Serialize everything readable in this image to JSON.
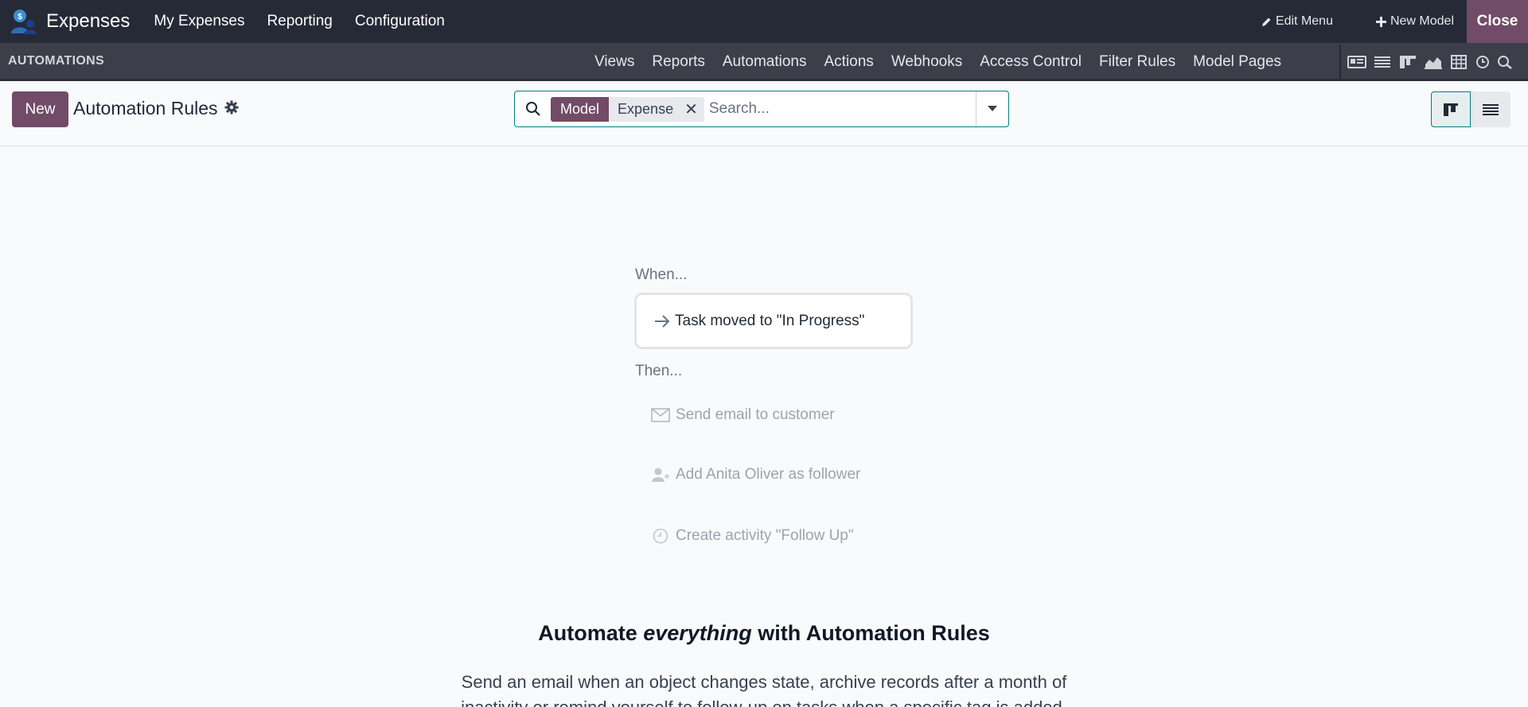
{
  "topbar": {
    "app_name": "Expenses",
    "menu": [
      "My Expenses",
      "Reporting",
      "Configuration"
    ],
    "edit_menu": "Edit Menu",
    "new_model": "New Model",
    "close": "Close"
  },
  "subbar": {
    "title": "AUTOMATIONS",
    "tabs": [
      "Views",
      "Reports",
      "Automations",
      "Actions",
      "Webhooks",
      "Access Control",
      "Filter Rules",
      "Model Pages"
    ],
    "view_icons": [
      "form-view-icon",
      "list-view-icon",
      "kanban-view-icon",
      "graph-view-icon",
      "pivot-view-icon",
      "activity-view-icon",
      "search-view-icon"
    ]
  },
  "control": {
    "new_button": "New",
    "page_title": "Automation Rules",
    "facet_key": "Model",
    "facet_value": "Expense",
    "search_placeholder": "Search..."
  },
  "helper": {
    "when": "When...",
    "trigger": "Task moved to \"In Progress\"",
    "then": "Then...",
    "actions": [
      "Send email to customer",
      "Add Anita Oliver as follower",
      "Create activity \"Follow Up\""
    ],
    "headline_pre": "Automate ",
    "headline_em": "everything",
    "headline_post": " with Automation Rules",
    "description": "Send an email when an object changes state, archive records after a month of inactivity or remind yourself to follow-up on tasks when a specific tag is added."
  },
  "colors": {
    "brand": "#714b67",
    "navbar": "#262a36",
    "accent": "#017e84"
  }
}
